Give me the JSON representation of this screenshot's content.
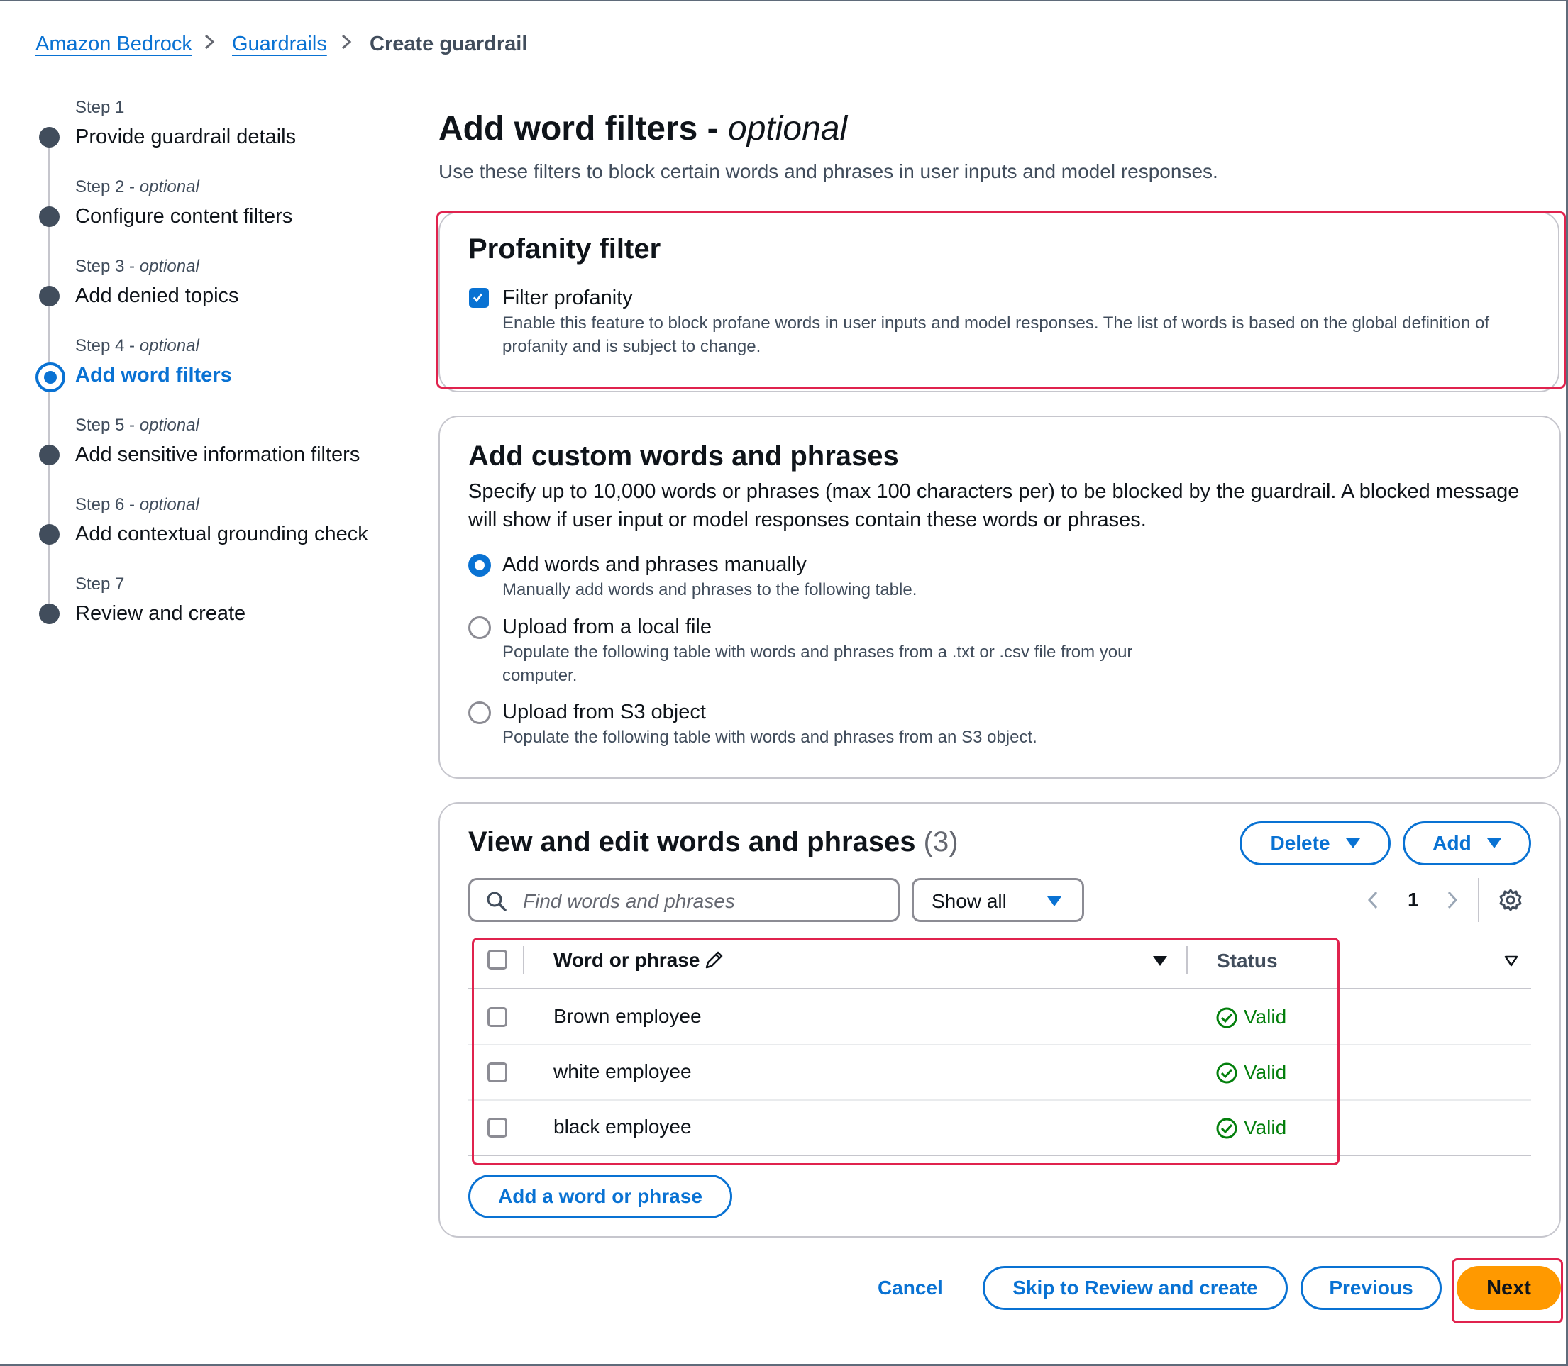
{
  "breadcrumb": {
    "items": [
      "Amazon Bedrock",
      "Guardrails"
    ],
    "current": "Create guardrail"
  },
  "steps": [
    {
      "label": "Step 1",
      "optional": "",
      "title": "Provide guardrail details"
    },
    {
      "label": "Step 2 - ",
      "optional": "optional",
      "title": "Configure content filters"
    },
    {
      "label": "Step 3 - ",
      "optional": "optional",
      "title": "Add denied topics"
    },
    {
      "label": "Step 4 - ",
      "optional": "optional",
      "title": "Add word filters",
      "active": true
    },
    {
      "label": "Step 5 - ",
      "optional": "optional",
      "title": "Add sensitive information filters"
    },
    {
      "label": "Step 6 - ",
      "optional": "optional",
      "title": "Add contextual grounding check"
    },
    {
      "label": "Step 7",
      "optional": "",
      "title": "Review and create"
    }
  ],
  "page": {
    "title": "Add word filters - ",
    "title_optional": "optional",
    "description": "Use these filters to block certain words and phrases in user inputs and model responses."
  },
  "profanity": {
    "title": "Profanity filter",
    "checkbox_label": "Filter profanity",
    "checked": true,
    "description_line1": "Enable this feature to block profane words in user inputs and model responses. The list of words is based on the global definition of",
    "description_line2": "profanity and is subject to change."
  },
  "custom": {
    "title": "Add custom words and phrases",
    "description_line1": "Specify up to 10,000 words or phrases (max 100 characters per) to be blocked by the guardrail. A blocked message",
    "description_line2": "will show if user input or model responses contain these words or phrases.",
    "options": [
      {
        "label": "Add words and phrases manually",
        "desc1": "Manually add words and phrases to the following table.",
        "desc2": "",
        "selected": true
      },
      {
        "label": "Upload from a local file",
        "desc1": "Populate the following table with words and phrases from a .txt or .csv file from your",
        "desc2": "computer.",
        "selected": false
      },
      {
        "label": "Upload from S3 object",
        "desc1": "Populate the following table with words and phrases from an S3 object.",
        "desc2": "",
        "selected": false
      }
    ]
  },
  "table": {
    "title": "View and edit words and phrases",
    "count": "(3)",
    "delete_label": "Delete",
    "add_label": "Add",
    "search_placeholder": "Find words and phrases",
    "filter_value": "Show all",
    "page_number": "1",
    "col_word": "Word or phrase",
    "col_status": "Status",
    "rows": [
      {
        "word": "Brown employee",
        "status": "Valid"
      },
      {
        "word": "white employee",
        "status": "Valid"
      },
      {
        "word": "black employee",
        "status": "Valid"
      }
    ],
    "add_word_label": "Add a word or phrase"
  },
  "footer": {
    "cancel": "Cancel",
    "skip": "Skip to Review and create",
    "previous": "Previous",
    "next": "Next"
  },
  "colors": {
    "accent": "#0972d3",
    "primary_button": "#ff9900",
    "valid": "#037f0c",
    "highlight": "#e0234e"
  }
}
